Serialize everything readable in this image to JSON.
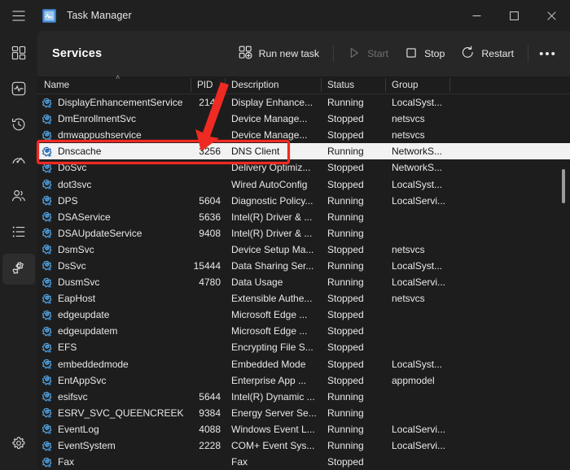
{
  "window": {
    "title": "Task Manager",
    "app_icon": "task-manager-icon",
    "menu_icon": "hamburger-menu-icon",
    "minimize_label": "–",
    "maximize_label": "□",
    "close_label": "✕"
  },
  "rail": {
    "items": [
      {
        "name": "processes",
        "icon": "grid-layout-icon"
      },
      {
        "name": "performance",
        "icon": "pulse-monitor-icon"
      },
      {
        "name": "app-history",
        "icon": "clock-history-icon"
      },
      {
        "name": "startup-apps",
        "icon": "speedometer-icon"
      },
      {
        "name": "users",
        "icon": "people-icon"
      },
      {
        "name": "details",
        "icon": "list-icon"
      },
      {
        "name": "services",
        "icon": "services-gear-icon",
        "active": true
      }
    ],
    "settings": {
      "name": "settings",
      "icon": "gear-icon"
    }
  },
  "toolbar": {
    "page_title": "Services",
    "run_new_task": "Run new task",
    "run_new_task_icon": "new-task-icon",
    "start": "Start",
    "start_icon": "play-triangle-icon",
    "start_disabled": true,
    "stop": "Stop",
    "stop_icon": "stop-square-icon",
    "restart": "Restart",
    "restart_icon": "restart-circular-arrow-icon",
    "more_label": "•••"
  },
  "table": {
    "columns": [
      {
        "key": "name",
        "label": "Name",
        "sorted": "asc",
        "sort_glyph": "˄"
      },
      {
        "key": "pid",
        "label": "PID"
      },
      {
        "key": "desc",
        "label": "Description"
      },
      {
        "key": "status",
        "label": "Status"
      },
      {
        "key": "group",
        "label": "Group"
      }
    ],
    "rows": [
      {
        "name": "DisplayEnhancementService",
        "pid": "2148",
        "desc": "Display Enhance...",
        "status": "Running",
        "group": "LocalSyst..."
      },
      {
        "name": "DmEnrollmentSvc",
        "pid": "",
        "desc": "Device Manage...",
        "status": "Stopped",
        "group": "netsvcs"
      },
      {
        "name": "dmwappushservice",
        "pid": "",
        "desc": "Device Manage...",
        "status": "Stopped",
        "group": "netsvcs"
      },
      {
        "name": "Dnscache",
        "pid": "3256",
        "desc": "DNS Client",
        "status": "Running",
        "group": "NetworkS...",
        "selected": true
      },
      {
        "name": "DoSvc",
        "pid": "",
        "desc": "Delivery Optimiz...",
        "status": "Stopped",
        "group": "NetworkS..."
      },
      {
        "name": "dot3svc",
        "pid": "",
        "desc": "Wired AutoConfig",
        "status": "Stopped",
        "group": "LocalSyst..."
      },
      {
        "name": "DPS",
        "pid": "5604",
        "desc": "Diagnostic Policy...",
        "status": "Running",
        "group": "LocalServi..."
      },
      {
        "name": "DSAService",
        "pid": "5636",
        "desc": "Intel(R) Driver & ...",
        "status": "Running",
        "group": ""
      },
      {
        "name": "DSAUpdateService",
        "pid": "9408",
        "desc": "Intel(R) Driver & ...",
        "status": "Running",
        "group": ""
      },
      {
        "name": "DsmSvc",
        "pid": "",
        "desc": "Device Setup Ma...",
        "status": "Stopped",
        "group": "netsvcs"
      },
      {
        "name": "DsSvc",
        "pid": "15444",
        "desc": "Data Sharing Ser...",
        "status": "Running",
        "group": "LocalSyst..."
      },
      {
        "name": "DusmSvc",
        "pid": "4780",
        "desc": "Data Usage",
        "status": "Running",
        "group": "LocalServi..."
      },
      {
        "name": "EapHost",
        "pid": "",
        "desc": "Extensible Authe...",
        "status": "Stopped",
        "group": "netsvcs"
      },
      {
        "name": "edgeupdate",
        "pid": "",
        "desc": "Microsoft Edge ...",
        "status": "Stopped",
        "group": ""
      },
      {
        "name": "edgeupdatem",
        "pid": "",
        "desc": "Microsoft Edge ...",
        "status": "Stopped",
        "group": ""
      },
      {
        "name": "EFS",
        "pid": "",
        "desc": "Encrypting File S...",
        "status": "Stopped",
        "group": ""
      },
      {
        "name": "embeddedmode",
        "pid": "",
        "desc": "Embedded Mode",
        "status": "Stopped",
        "group": "LocalSyst..."
      },
      {
        "name": "EntAppSvc",
        "pid": "",
        "desc": "Enterprise App ...",
        "status": "Stopped",
        "group": "appmodel"
      },
      {
        "name": "esifsvc",
        "pid": "5644",
        "desc": "Intel(R) Dynamic ...",
        "status": "Running",
        "group": ""
      },
      {
        "name": "ESRV_SVC_QUEENCREEK",
        "pid": "9384",
        "desc": "Energy Server Se...",
        "status": "Running",
        "group": ""
      },
      {
        "name": "EventLog",
        "pid": "4088",
        "desc": "Windows Event L...",
        "status": "Running",
        "group": "LocalServi..."
      },
      {
        "name": "EventSystem",
        "pid": "2228",
        "desc": "COM+ Event Sys...",
        "status": "Running",
        "group": "LocalServi..."
      },
      {
        "name": "Fax",
        "pid": "",
        "desc": "Fax",
        "status": "Stopped",
        "group": ""
      }
    ],
    "row_icon": "service-gear-icon"
  },
  "annotations": {
    "highlight_color": "#ef2a22",
    "highlight_target": "Dnscache",
    "arrow": "red-down-arrow"
  },
  "colors": {
    "accent": "#4cc2ff",
    "window_bg": "#202020",
    "content_bg": "#272727",
    "table_bg": "#1d1d1d",
    "selected_row_bg": "#f2f2f2",
    "icon_blue": "#4a9fe0"
  }
}
